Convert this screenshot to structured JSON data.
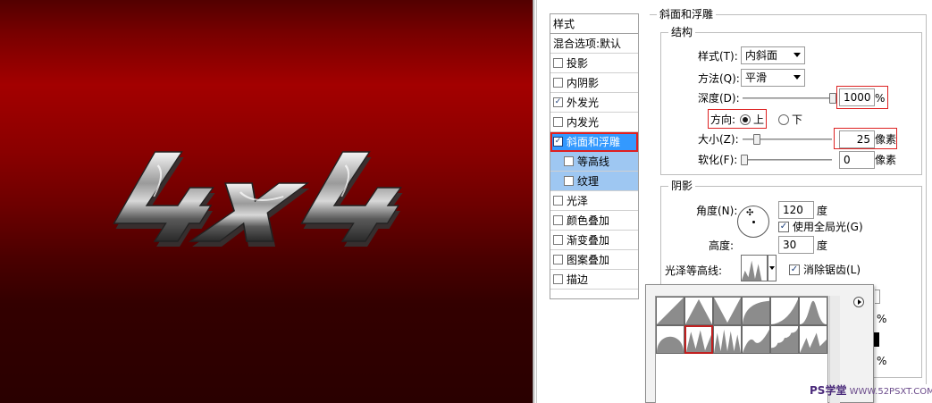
{
  "canvas": {
    "art_label": "4x4",
    "background_colors": [
      "#520000",
      "#a30000",
      "#2a0000"
    ]
  },
  "styles_panel": {
    "header": "样式",
    "blend_options": "混合选项:默认",
    "items": [
      {
        "label": "投影",
        "checked": false
      },
      {
        "label": "内阴影",
        "checked": false
      },
      {
        "label": "外发光",
        "checked": true
      },
      {
        "label": "内发光",
        "checked": false
      },
      {
        "label": "斜面和浮雕",
        "checked": true,
        "selected": true
      },
      {
        "label": "等高线",
        "checked": false,
        "sub": true
      },
      {
        "label": "纹理",
        "checked": false,
        "sub": true
      },
      {
        "label": "光泽",
        "checked": false
      },
      {
        "label": "颜色叠加",
        "checked": false
      },
      {
        "label": "渐变叠加",
        "checked": false
      },
      {
        "label": "图案叠加",
        "checked": false
      },
      {
        "label": "描边",
        "checked": false
      }
    ]
  },
  "bevel": {
    "section_title": "斜面和浮雕",
    "structure": {
      "title": "结构",
      "style_label": "样式(T):",
      "style_value": "内斜面",
      "technique_label": "方法(Q):",
      "technique_value": "平滑",
      "depth_label": "深度(D):",
      "depth_value": "1000",
      "depth_unit": "%",
      "depth_level": 1.0,
      "direction_label": "方向:",
      "direction_up": "上",
      "direction_down": "下",
      "direction_selected": "上",
      "size_label": "大小(Z):",
      "size_value": "25",
      "size_unit": "像素",
      "soften_label": "软化(F):",
      "soften_value": "0",
      "soften_unit": "像素"
    },
    "shading": {
      "title": "阴影",
      "angle_label": "角度(N):",
      "angle_value": "120",
      "angle_unit": "度",
      "global_light_label": "使用全局光(G)",
      "global_light_checked": true,
      "altitude_label": "高度:",
      "altitude_value": "30",
      "altitude_unit": "度",
      "gloss_contour_label": "光泽等高线:",
      "anti_alias_label": "消除锯齿(L)",
      "anti_alias_checked": true
    },
    "obscured_percent_1": "%",
    "obscured_percent_2": "%"
  },
  "contour_picker": {
    "cells": [
      "linear",
      "cone",
      "cone-inverted",
      "cove-deep",
      "cove-shallow",
      "gaussian",
      "half-round",
      "ring",
      "ring-double",
      "rolling-slope",
      "rounded-steps",
      "sawtooth"
    ],
    "selected_index": 7
  },
  "watermark": {
    "brand": "PS学堂",
    "site": "WWW.52PSXT.COM"
  },
  "accent_color": "#3399ff",
  "highlight_color": "#e02020"
}
